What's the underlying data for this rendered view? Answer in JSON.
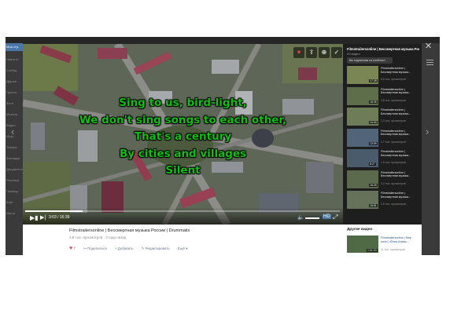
{
  "sidebar": {
    "items": [
      "Моя стр.",
      "Новости",
      "Сообщ.",
      "Друзья",
      "Группы",
      "Фото",
      "Музыка",
      "Видео",
      "Игры",
      "Товары",
      "Закладки",
      "Документы",
      "Реклама",
      "Помощь",
      "Ещё",
      "Настр."
    ]
  },
  "player": {
    "lyrics": [
      "Sing to us, bird-light,",
      "We don't sing songs to each other,",
      "That's a century",
      "By cities and villages",
      "Silent"
    ],
    "current_time": "3:03",
    "duration": "16:39",
    "progress": 0.183,
    "icons": {
      "play": "▶▮",
      "next": "▶|",
      "volume": "🔈",
      "quality": "HD",
      "fullscreen": "⤢",
      "heart": "♥",
      "share": "⇪",
      "add": "⊕",
      "done": "✓",
      "prev_nav": "‹",
      "next_nav": "›",
      "close": "✕"
    }
  },
  "video": {
    "title": "Filmstrailersonline | Бессмертная музыка России | Drummatix",
    "meta": "3,8 тыс. просмотров · 2 года назад",
    "actions": {
      "likes": "7",
      "share": "Поделиться",
      "add": "Добавить",
      "edit": "Редактировать",
      "more": "Ещё"
    }
  },
  "panel": {
    "title": "Filmstrailersonline | Бессмертная музыка России",
    "subtitle": "20 видео",
    "subscribed": "Вы подписаны на плейлист",
    "items": [
      {
        "title": "Filmstrailersonline |",
        "title2": "Бессмертная музыка...",
        "views": "5,6 тыс. просмотров",
        "dur": "17:28"
      },
      {
        "title": "Filmstrailersonline |",
        "title2": "Бессмертная музыка...",
        "views": "3,8 тыс. просмотров",
        "dur": "16:39"
      },
      {
        "title": "Filmstrailersonline |",
        "title2": "Бессмертная музыка...",
        "views": "1,3 тыс. просмотров",
        "dur": "14:44"
      },
      {
        "title": "Filmstrailersonline |",
        "title2": "Бессмертная музыка...",
        "views": "2,7 тыс. просмотров",
        "dur": "13:09"
      },
      {
        "title": "Filmstrailersonline |",
        "title2": "Бессмертная музыка...",
        "views": "1,9 тыс. просмотров",
        "dur": "8:27"
      },
      {
        "title": "Filmstrailersonline |",
        "title2": "Бессмертная музыка...",
        "views": "3,2 тыс. просмотров",
        "dur": "16:25"
      },
      {
        "title": "Filmstrailersonline |",
        "title2": "Бессмертная музыка...",
        "views": "1,6 тыс. просмотров",
        "dur": "16:51"
      }
    ]
  },
  "other": {
    "heading": "Другие видео",
    "title": "Filmstrailersonline | Мир",
    "title2": "кино! | Юлия Алмаз...",
    "views": "11 тыс. просмотров",
    "dur": "1:01:33"
  }
}
